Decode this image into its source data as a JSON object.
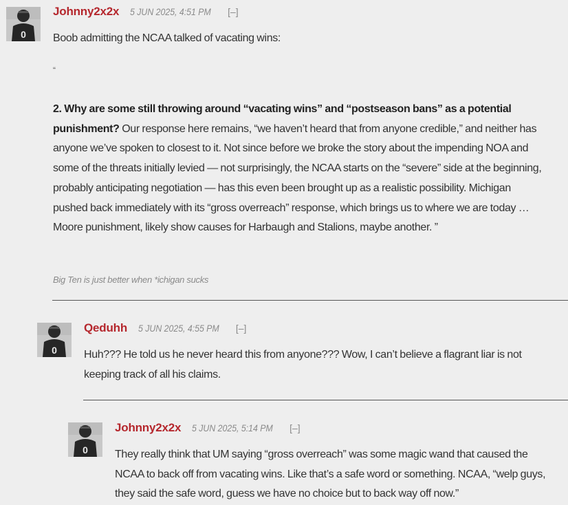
{
  "comments": [
    {
      "author": "Johnny2x2x",
      "date": "5 JUN 2025, 4:51 PM",
      "collapse": "[–]",
      "intro": "Boob admitting the NCAA talked of vacating wins:",
      "quote_mark": "“",
      "bold_lead": "2. Why are some still throwing around “vacating wins” and “postseason bans” as a potential punishment?",
      "body": " Our response here remains, “we haven’t heard that from anyone credible,” and neither has anyone we’ve spoken to closest to it. Not since before we broke the story about the impending NOA and some of the threats initially levied — not surprisingly, the NCAA starts on the “severe” side at the beginning, probably anticipating negotiation — has this even been brought up as a realistic possibility. Michigan pushed back immediately with its “gross overreach” response, which brings us to where we are today … Moore punishment, likely show causes for Harbaugh and Stalions, maybe another. ”",
      "signature": "Big Ten is just better when *ichigan sucks"
    },
    {
      "author": "Qeduhh",
      "date": "5 JUN 2025, 4:55 PM",
      "collapse": "[–]",
      "body": "Huh??? He told us he never heard this from anyone??? Wow, I can’t believe a flagrant liar is not keeping track of all his claims."
    },
    {
      "author": "Johnny2x2x",
      "date": "5 JUN 2025, 5:14 PM",
      "collapse": "[–]",
      "body": "They really think that UM saying “gross overreach” was some magic wand that caused the NCAA to back off from vacating wins.  Like that’s a safe word or something.  NCAA, “welp guys, they said the safe word, guess we have no choice but to back way off now.”"
    }
  ],
  "avatar_jersey_number": "0",
  "colors": {
    "author": "#b5272d",
    "background": "#eeeeee",
    "text": "#333333",
    "meta": "#8a8a8a"
  }
}
